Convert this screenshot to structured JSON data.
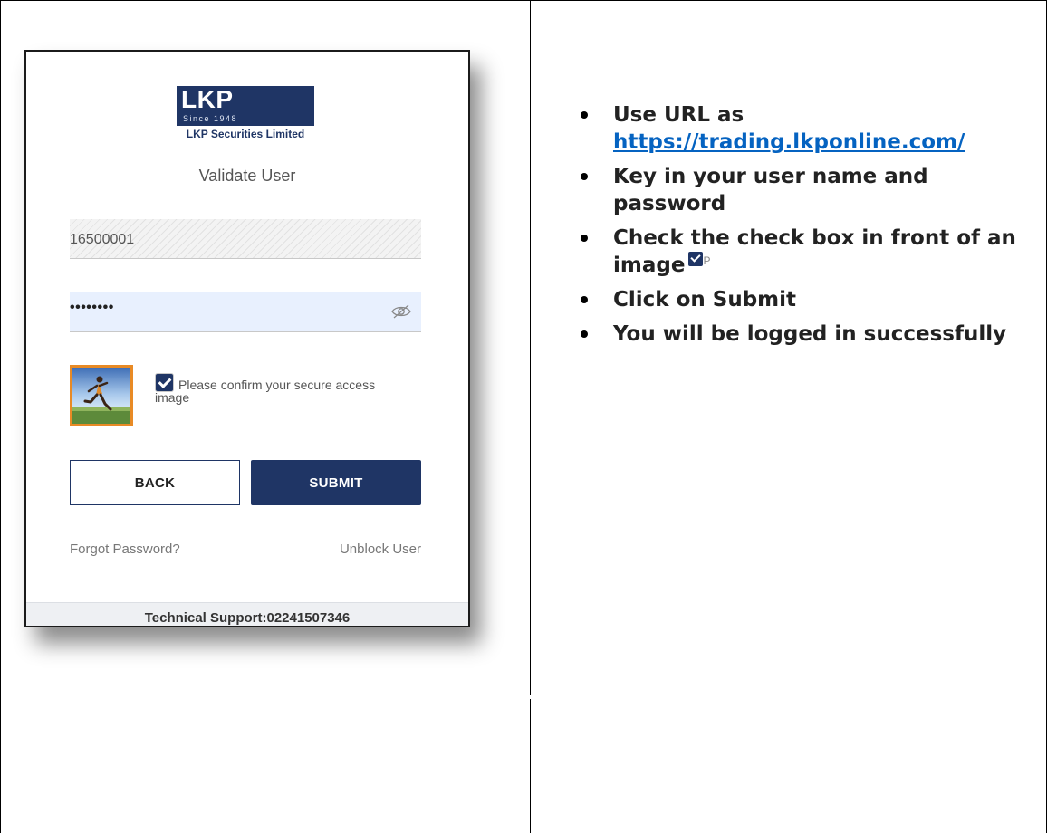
{
  "login": {
    "logo_mark": "LKP",
    "logo_since": "Since 1948",
    "company_name": "LKP Securities Limited",
    "title": "Validate User",
    "username_value": "16500001",
    "password_value": "••••••••",
    "confirm_label": "Please confirm your secure access image",
    "checkbox_checked": true,
    "back_label": "BACK",
    "submit_label": "SUBMIT",
    "forgot_label": "Forgot Password?",
    "unblock_label": "Unblock User",
    "support_label": "Technical Support:02241507346",
    "colors": {
      "brand": "#1f3565",
      "image_border": "#e88a25",
      "password_bg": "#e8f0fe"
    }
  },
  "steps": {
    "step1_prefix": "Use URL as",
    "step1_url": "https://trading.lkponline.com/",
    "step2": "Key in your user name and password",
    "step3_text": "Check the check box in front of an image",
    "step3_suffix": "P",
    "step4": "Click on Submit",
    "step5": "You will be logged in successfully"
  }
}
